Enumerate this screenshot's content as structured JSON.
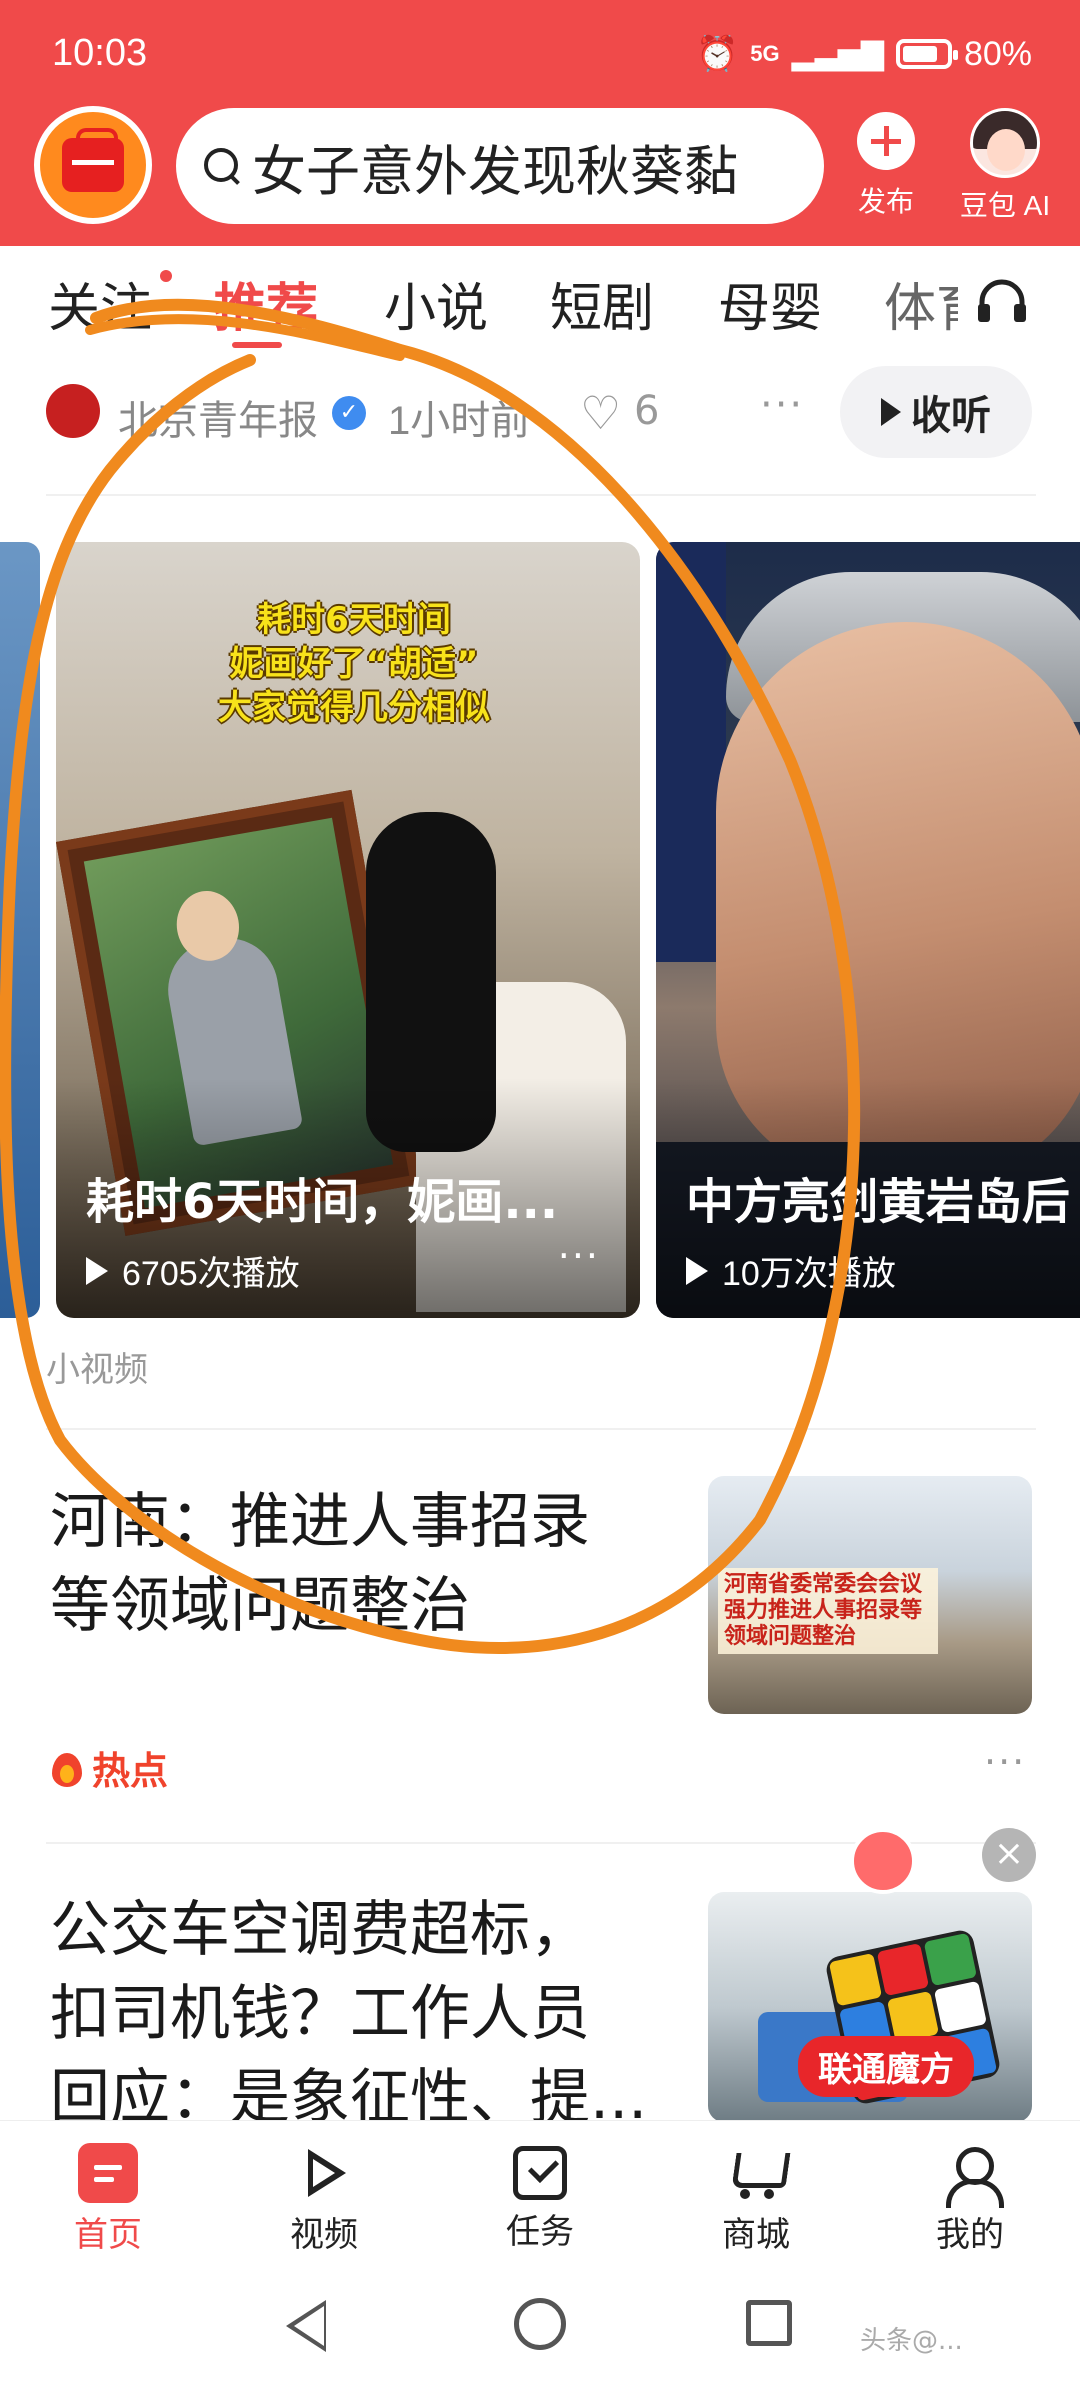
{
  "status_bar": {
    "time": "10:03",
    "network": "5G",
    "battery": "80%"
  },
  "header": {
    "search_text": "女子意外发现秋葵黏",
    "publish_label": "发布",
    "ai_label": "豆包 AI"
  },
  "tabs": [
    {
      "label": "关注"
    },
    {
      "label": "推荐"
    },
    {
      "label": "小说"
    },
    {
      "label": "短剧"
    },
    {
      "label": "母婴"
    },
    {
      "label": "体育"
    }
  ],
  "card": {
    "source": "北京青年报",
    "time": "1小时前",
    "likes": "6",
    "listen_label": "收听",
    "section": "小视频",
    "videos": [
      {
        "overlay_caption_lines": [
          "耗时6天时间",
          "妮画好了“胡适”",
          "大家觉得几分相似"
        ],
        "title": "耗时6天时间，妮画...",
        "plays": "6705次播放"
      },
      {
        "title": "中方亮剑黄岩岛后",
        "plays": "10万次播放"
      }
    ]
  },
  "news": [
    {
      "title_lines": [
        "河南：推进人事招录",
        "等领域问题整治"
      ],
      "thumb_caption": "河南省委常委会会议 强力推进人事招录等领域问题整治"
    },
    {
      "tag": "热点"
    },
    {
      "title_lines": [
        "公交车空调费超标，",
        "扣司机钱？工作人员",
        "回应：是象征性、提..."
      ],
      "thumb_label": "联通魔方"
    }
  ],
  "bottom_nav": [
    {
      "label": "首页",
      "icon": "home-icon"
    },
    {
      "label": "视频",
      "icon": "video-icon"
    },
    {
      "label": "任务",
      "icon": "task-icon"
    },
    {
      "label": "商城",
      "icon": "cart-icon"
    },
    {
      "label": "我的",
      "icon": "profile-icon"
    }
  ],
  "watermark": "头条@..."
}
